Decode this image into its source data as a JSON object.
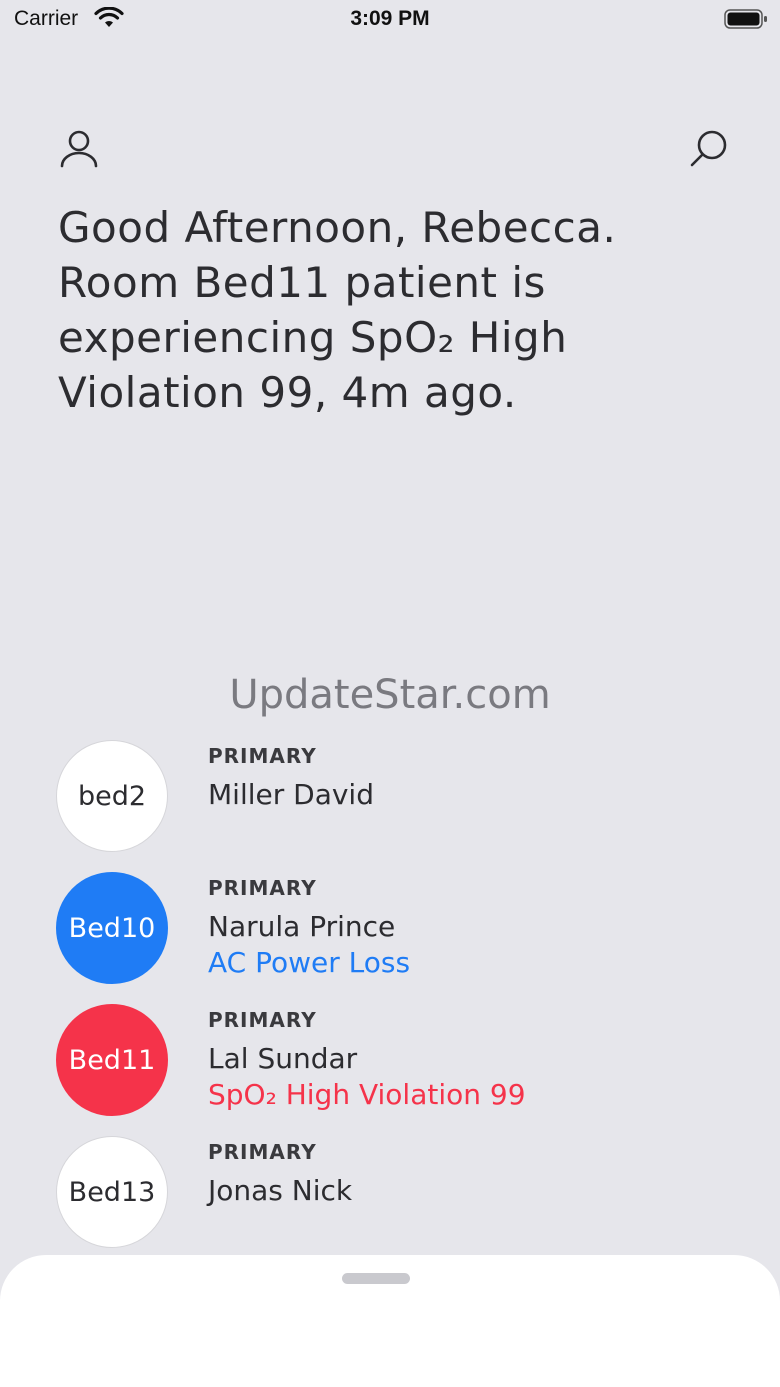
{
  "status_bar": {
    "carrier": "Carrier",
    "time": "3:09 PM"
  },
  "header": {
    "profile_icon": "person-icon",
    "search_icon": "search-icon"
  },
  "greeting": {
    "line1": "Good Afternoon, Rebecca.",
    "line2": "Room Bed11 patient is",
    "line3": "experiencing SpO₂ High",
    "line4": "Violation 99, 4m ago."
  },
  "watermark": "UpdateStar.com",
  "patients": [
    {
      "bed": "bed2",
      "role": "PRIMARY",
      "name": "Miller David",
      "alarm": ""
    },
    {
      "bed": "Bed10",
      "role": "PRIMARY",
      "name": "Narula Prince",
      "alarm": "AC Power Loss"
    },
    {
      "bed": "Bed11",
      "role": "PRIMARY",
      "name": "Lal Sundar",
      "alarm": "SpO₂ High Violation 99"
    },
    {
      "bed": "Bed13",
      "role": "PRIMARY",
      "name": "Jonas Nick",
      "alarm": ""
    }
  ],
  "colors": {
    "background": "#e6e6eb",
    "alarm_blue": "#1f7cf5",
    "alarm_red": "#f5334a"
  }
}
